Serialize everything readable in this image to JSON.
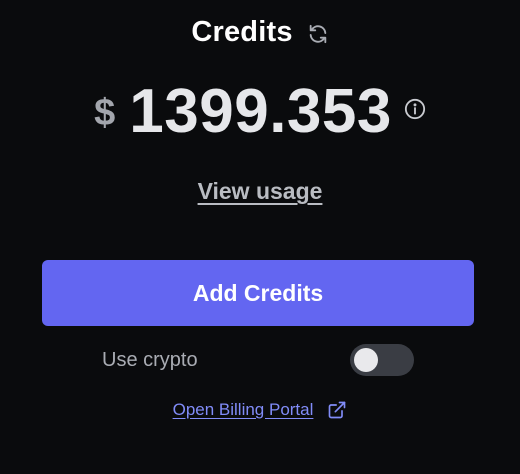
{
  "header": {
    "title": "Credits",
    "refresh_icon": "refresh-icon"
  },
  "balance": {
    "currency_symbol": "$",
    "amount": "1399.353",
    "info_icon": "info-icon"
  },
  "links": {
    "view_usage": "View usage",
    "billing_portal": "Open Billing Portal",
    "billing_portal_icon": "external-link-icon"
  },
  "actions": {
    "add_credits": "Add Credits"
  },
  "crypto": {
    "label": "Use crypto",
    "enabled": false
  },
  "colors": {
    "background": "#0a0b0d",
    "accent": "#6366f1",
    "link": "#818cf8"
  }
}
